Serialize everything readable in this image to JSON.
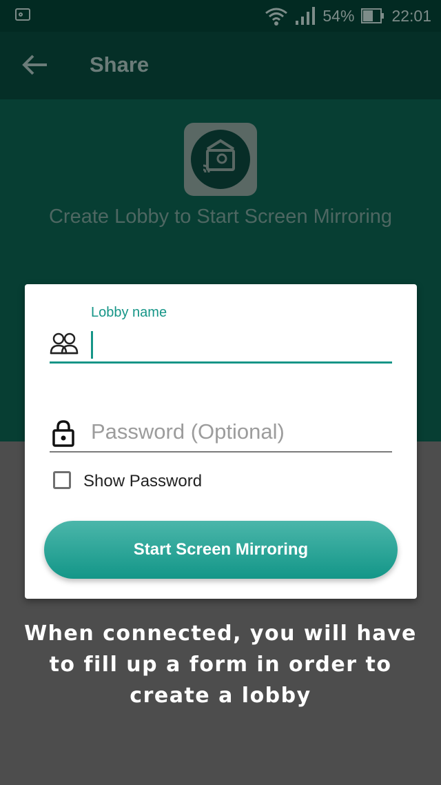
{
  "status_bar": {
    "battery_percent": "54%",
    "time": "22:01"
  },
  "app_bar": {
    "title": "Share"
  },
  "hero": {
    "headline": "Create Lobby to Start Screen Mirroring"
  },
  "dialog": {
    "lobby_name_label": "Lobby name",
    "lobby_name_value": "",
    "password_placeholder": "Password (Optional)",
    "show_password_label": "Show Password",
    "show_password_checked": false,
    "start_button_label": "Start Screen Mirroring"
  },
  "caption": {
    "line1": "When connected, you will have",
    "line2": "to fill up a form in order to",
    "line3": "create a lobby"
  },
  "colors": {
    "accent": "#159587",
    "app_bar_dimmed": "#052f27",
    "overlay_gray": "#4d4d4d"
  },
  "icons": [
    "radio-icon",
    "wifi-icon",
    "signal-icon",
    "battery-icon",
    "back-arrow-icon",
    "app-logo-icon",
    "group-icon",
    "lock-icon",
    "checkbox-icon"
  ]
}
